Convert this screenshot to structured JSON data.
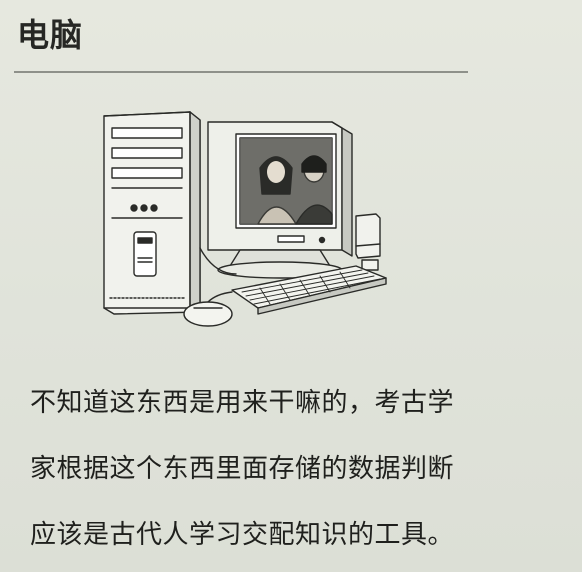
{
  "title": "电脑",
  "illustration": {
    "monitor_brand": "",
    "icons": [
      "computer-tower-icon",
      "crt-monitor-icon",
      "keyboard-icon",
      "mouse-icon",
      "speaker-icon",
      "photo-on-screen-icon"
    ]
  },
  "body": {
    "lines": [
      "不知道这东西是用来干嘛的，考古学",
      "家根据这个东西里面存储的数据判断",
      "应该是古代人学习交配知识的工具。"
    ]
  },
  "colors": {
    "paper": "#e3e5dc",
    "ink": "#1b1c1a",
    "rule": "#8e918a"
  }
}
